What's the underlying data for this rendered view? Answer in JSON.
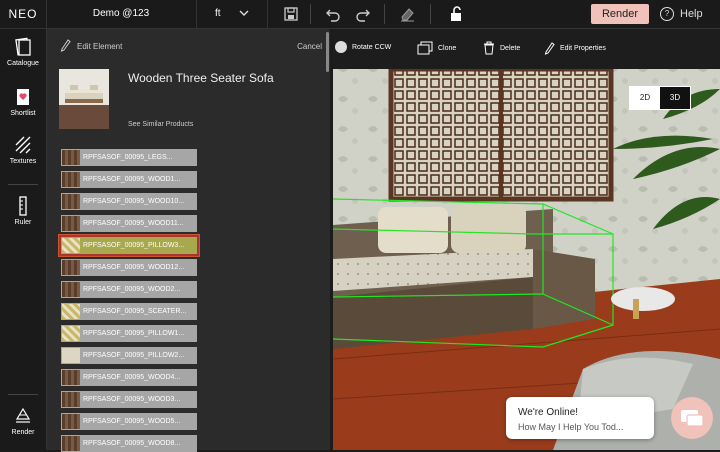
{
  "app": {
    "logo": "NEO",
    "project_name": "Demo @123",
    "unit": "ft"
  },
  "topbar": {
    "render_label": "Render",
    "help_label": "Help",
    "help_glyph": "?"
  },
  "leftnav": {
    "items": [
      "Catalogue",
      "Shortlist",
      "Textures",
      "Ruler",
      "Render"
    ]
  },
  "panel": {
    "title": "Edit Element",
    "cancel": "Cancel",
    "product_name": "Wooden Three Seater Sofa",
    "similar": "See Similar Products",
    "materials": [
      {
        "label": "RPFSASOF_00095_LEGS...",
        "swatch": "wood"
      },
      {
        "label": "RPFSASOF_00095_WOOD1...",
        "swatch": "wood"
      },
      {
        "label": "RPFSASOF_00095_WOOD10...",
        "swatch": "wood"
      },
      {
        "label": "RPFSASOF_00095_WOOD11...",
        "swatch": "wood"
      },
      {
        "label": "RPFSASOF_00095_PILLOW3...",
        "swatch": "pattern",
        "selected": true
      },
      {
        "label": "RPFSASOF_00095_WOOD12...",
        "swatch": "wood"
      },
      {
        "label": "RPFSASOF_00095_WOOD2...",
        "swatch": "wood"
      },
      {
        "label": "RPFSASOF_00095_SCEATER...",
        "swatch": "pattern"
      },
      {
        "label": "RPFSASOF_00095_PILLOW1...",
        "swatch": "pattern"
      },
      {
        "label": "RPFSASOF_00095_PILLOW2...",
        "swatch": "plain"
      },
      {
        "label": "RPFSASOF_00095_WOOD4...",
        "swatch": "wood"
      },
      {
        "label": "RPFSASOF_00095_WOOD3...",
        "swatch": "wood"
      },
      {
        "label": "RPFSASOF_00095_WOOD5...",
        "swatch": "wood"
      },
      {
        "label": "RPFSASOF_00095_WOOD8...",
        "swatch": "wood"
      }
    ]
  },
  "viewport": {
    "toolbar": {
      "rotate": "Rotate CCW",
      "clone": "Clone",
      "delete": "Delete",
      "edit_props": "Edit Properties"
    },
    "view_2d": "2D",
    "view_3d": "3D",
    "active_view": "3D",
    "chat": {
      "line1": "We're Online!",
      "line2": "How May I Help You Tod..."
    }
  },
  "colors": {
    "accent": "#f0c2ba",
    "selection_outline": "#c9552d",
    "bbox_green": "#22e622"
  }
}
